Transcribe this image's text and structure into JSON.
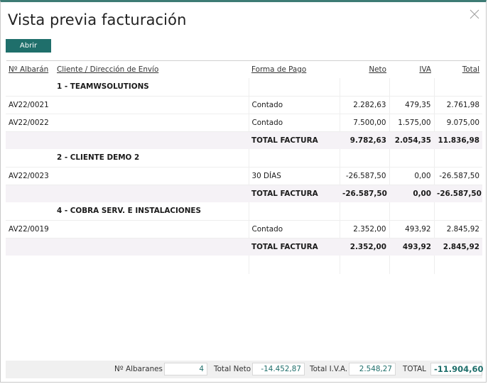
{
  "window": {
    "title": "Vista previa facturación"
  },
  "toolbar": {
    "open_label": "Abrir"
  },
  "table": {
    "headers": {
      "albaran": "Nº Albarán",
      "cliente": "Cliente / Dirección de Envío",
      "forma": "Forma de Pago",
      "neto": "Neto",
      "iva": "IVA",
      "total": "Total"
    },
    "groups": [
      {
        "name": "1 - TEAMWSOLUTIONS",
        "rows": [
          {
            "albaran": "AV22/0021",
            "forma": "Contado",
            "neto": "2.282,63",
            "iva": "479,35",
            "total": "2.761,98"
          },
          {
            "albaran": "AV22/0022",
            "forma": "Contado",
            "neto": "7.500,00",
            "iva": "1.575,00",
            "total": "9.075,00"
          }
        ],
        "total": {
          "label": "TOTAL FACTURA",
          "neto": "9.782,63",
          "iva": "2.054,35",
          "total": "11.836,98"
        }
      },
      {
        "name": "2 - CLIENTE DEMO 2",
        "rows": [
          {
            "albaran": "AV22/0023",
            "forma": "30 DÍAS",
            "neto": "-26.587,50",
            "iva": "0,00",
            "total": "-26.587,50"
          }
        ],
        "total": {
          "label": "TOTAL FACTURA",
          "neto": "-26.587,50",
          "iva": "0,00",
          "total": "-26.587,50"
        }
      },
      {
        "name": "4 - COBRA SERV. E INSTALACIONES",
        "rows": [
          {
            "albaran": "AV22/0019",
            "forma": "Contado",
            "neto": "2.352,00",
            "iva": "493,92",
            "total": "2.845,92"
          }
        ],
        "total": {
          "label": "TOTAL FACTURA",
          "neto": "2.352,00",
          "iva": "493,92",
          "total": "2.845,92"
        }
      }
    ]
  },
  "footer": {
    "albaranes_label": "Nº Albaranes",
    "albaranes_value": "4",
    "neto_label": "Total Neto",
    "neto_value": "-14.452,87",
    "iva_label": "Total I.V.A.",
    "iva_value": "2.548,27",
    "total_label": "TOTAL",
    "total_value": "-11.904,60"
  }
}
